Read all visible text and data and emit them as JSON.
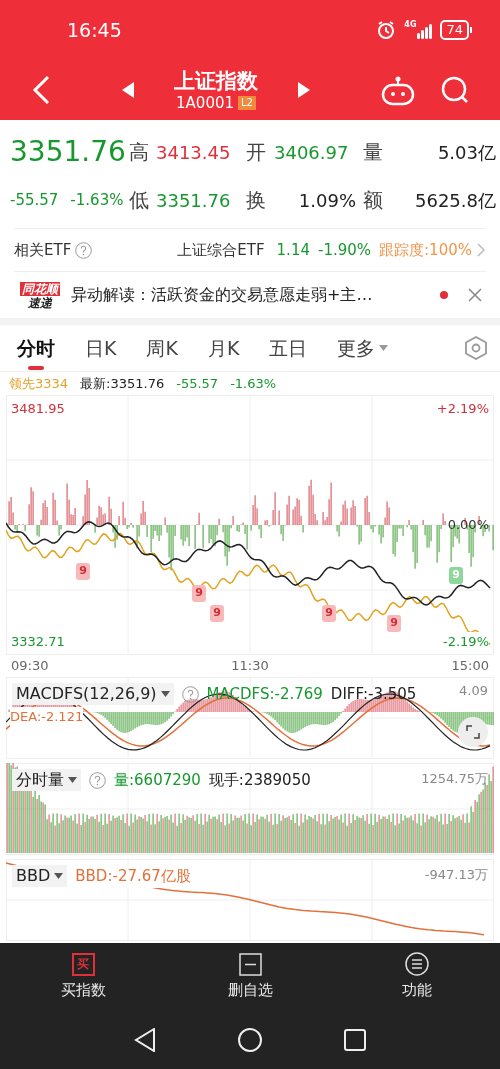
{
  "status_bar": {
    "time": "16:45",
    "network": "4G",
    "battery": "74"
  },
  "header": {
    "title": "上证指数",
    "code": "1A0001",
    "badge": "L2"
  },
  "quote": {
    "price": "3351.76",
    "change": "-55.57",
    "change_pct": "-1.63%",
    "stats": [
      {
        "label": "高",
        "value": "3413.45",
        "color": "#e0303a"
      },
      {
        "label": "开",
        "value": "3406.97",
        "color": "#17982f"
      },
      {
        "label": "量",
        "value": "5.03亿",
        "color": "#222222"
      },
      {
        "label": "低",
        "value": "3351.76",
        "color": "#17982f"
      },
      {
        "label": "换",
        "value": "1.09%",
        "color": "#222222"
      },
      {
        "label": "额",
        "value": "5625.8亿",
        "color": "#222222"
      }
    ]
  },
  "etf": {
    "label": "相关ETF",
    "name": "上证综合ETF",
    "price": "1.14",
    "change_pct": "-1.90%",
    "tracking": "跟踪度:100%"
  },
  "news": {
    "logo_top": "同花顺",
    "logo_bottom": "速递",
    "text": "异动解读：活跃资金的交易意愿走弱+主…",
    "unread": true
  },
  "tabs": [
    {
      "label": "分时",
      "selected": true,
      "kind": "plain"
    },
    {
      "label": "日K",
      "selected": false,
      "kind": "plain"
    },
    {
      "label": "周K",
      "selected": false,
      "kind": "plain"
    },
    {
      "label": "月K",
      "selected": false,
      "kind": "plain"
    },
    {
      "label": "五日",
      "selected": false,
      "kind": "plain"
    },
    {
      "label": "更多",
      "selected": false,
      "kind": "dropdown"
    }
  ],
  "chart_info": {
    "leader": "领先3334",
    "latest": "最新:3351.76",
    "change": "-55.57",
    "change_pct": "-1.63%"
  },
  "main_chart": {
    "y_high": "3481.95",
    "y_low": "3332.71",
    "pct_high": "+2.19%",
    "pct_zero": "0.00%",
    "pct_low": "-2.19%",
    "signals": [
      {
        "label": "9",
        "color": "#f7b9b9"
      },
      {
        "label": "9",
        "color": "#f7b9b9"
      },
      {
        "label": "9",
        "color": "#f7b9b9"
      },
      {
        "label": "9",
        "color": "#f7b9b9"
      },
      {
        "label": "9",
        "color": "#f7b9b9"
      },
      {
        "label": "9",
        "color": "#8ed69a"
      }
    ]
  },
  "time_axis": [
    "09:30",
    "11:30",
    "15:00"
  ],
  "macd": {
    "selector": "MACDFS(12,26,9)",
    "macdfs": "MACDFS:-2.769",
    "diff": "DIFF:-3.505",
    "dea": "DEA:-2.121",
    "scale": "4.09"
  },
  "volume": {
    "selector": "分时量",
    "volume": "量:6607290",
    "current": "现手:2389050",
    "scale": "1254.75万"
  },
  "bbd": {
    "selector": "BBD",
    "value": "BBD:-27.67亿股",
    "scale": "-947.13万"
  },
  "bottom_nav": [
    {
      "label": "买指数",
      "kind": "buy",
      "icon_char": "买"
    },
    {
      "label": "删自选",
      "kind": "remove"
    },
    {
      "label": "功能",
      "kind": "menu"
    }
  ]
}
